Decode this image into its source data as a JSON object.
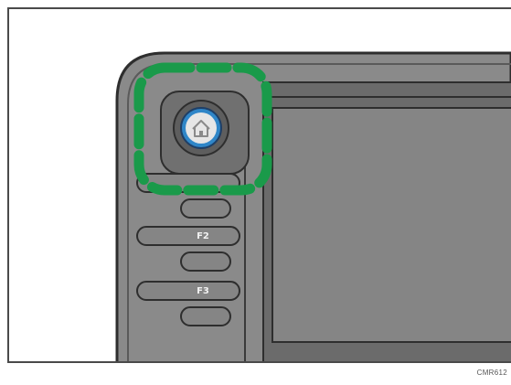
{
  "function_keys": [
    {
      "label": ""
    },
    {
      "label": "F2"
    },
    {
      "label": "F3"
    }
  ],
  "home_button": {
    "icon": "home-icon"
  },
  "highlight": {
    "style": "dashed",
    "color": "#1a9a4a"
  },
  "colors": {
    "panel_body": "#8a8a8a",
    "panel_edge": "#3a3a3a",
    "screen": "#858585",
    "highlight": "#1a9a4a",
    "home_ring": "#2f86c8"
  },
  "caption": "CMR612"
}
